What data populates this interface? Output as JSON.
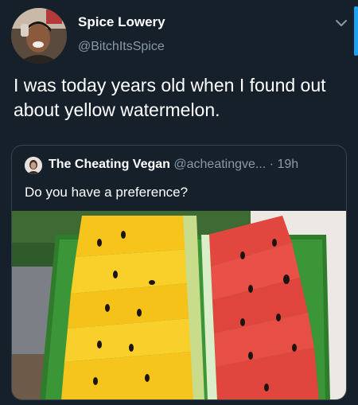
{
  "author": {
    "name": "Spice Lowery",
    "handle": "@BitchItsSpice"
  },
  "tweet": {
    "text": "I was today years old when I found out about yellow watermelon."
  },
  "quoted_tweet": {
    "name": "The Cheating Vegan",
    "handle": "@acheatingve...",
    "separator": "·",
    "time": "19h",
    "text": "Do you have a preference?"
  },
  "icons": {
    "caret": "chevron-down-icon",
    "author_avatar": "avatar",
    "quote_avatar": "avatar"
  },
  "colors": {
    "background": "#15202b",
    "secondary_text": "#8899a6",
    "border": "#38444d",
    "accent": "#1da1f2",
    "yellow_melon": "#f5c518",
    "red_melon": "#e0463f",
    "rind_green": "#3f8f3a"
  }
}
